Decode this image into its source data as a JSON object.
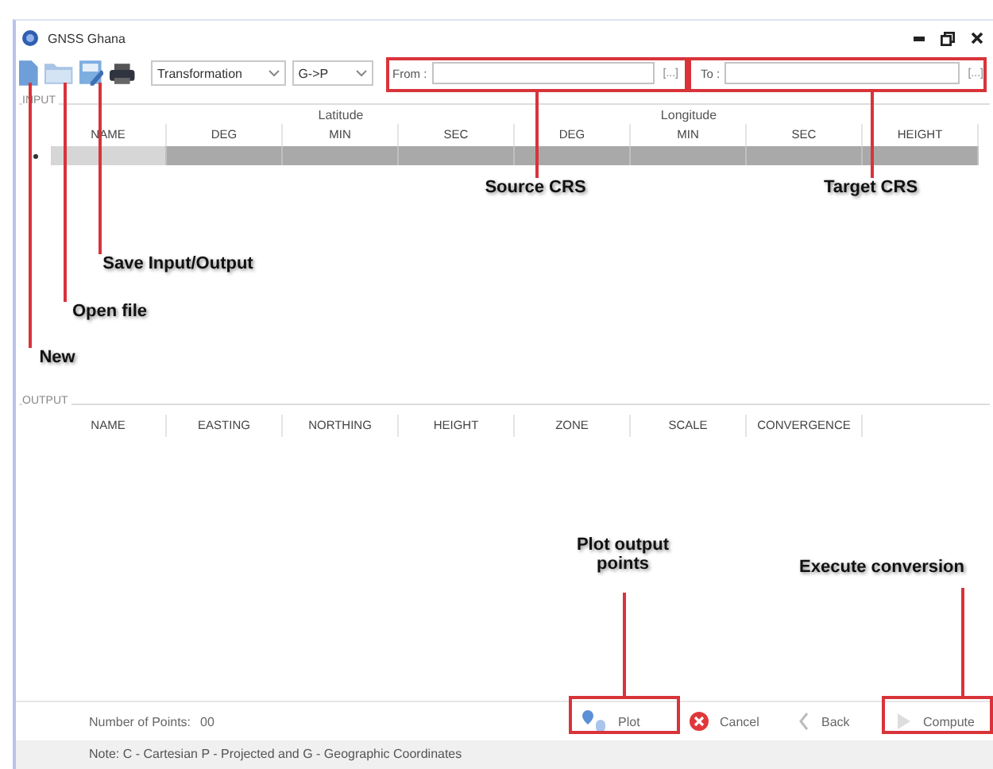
{
  "window": {
    "title": "GNSS Ghana"
  },
  "toolbar": {
    "dropdowns": [
      {
        "value": "Transformation"
      },
      {
        "value": "G->P"
      }
    ],
    "crs_fields": [
      {
        "label": "From :",
        "browse": "[...]"
      },
      {
        "label": "To :",
        "browse": "[...]"
      }
    ]
  },
  "input": {
    "legend": "INPUT",
    "column_groups": [
      {
        "columns": [
          "NAME"
        ]
      },
      {
        "label": "Latitude",
        "columns": [
          "DEG",
          "MIN",
          "SEC"
        ]
      },
      {
        "label": "Longitude",
        "columns": [
          "DEG",
          "MIN",
          "SEC"
        ]
      },
      {
        "columns": [
          "HEIGHT"
        ]
      }
    ],
    "rows": [
      {
        "selected": true
      }
    ]
  },
  "output": {
    "legend": "OUTPUT",
    "columns": [
      "NAME",
      "EASTING",
      "NORTHING",
      "HEIGHT",
      "ZONE",
      "SCALE",
      "CONVERGENCE"
    ]
  },
  "footer": {
    "points_label": "Number of Points:",
    "points": "00",
    "buttons": [
      {
        "kind": "plot",
        "label": "Plot"
      },
      {
        "kind": "cancel",
        "label": "Cancel"
      },
      {
        "kind": "back",
        "label": "Back"
      },
      {
        "kind": "compute",
        "label": "Compute"
      }
    ]
  },
  "note": "Note: C - Cartesian  P - Projected  and G - Geographic Coordinates",
  "annotations": [
    {
      "kind": "from",
      "text": "Source CRS"
    },
    {
      "kind": "to",
      "text": "Target CRS"
    },
    {
      "kind": "save",
      "text": "Save Input/Output"
    },
    {
      "kind": "open",
      "text": "Open file"
    },
    {
      "kind": "new",
      "text": "New"
    },
    {
      "kind": "plot",
      "text": "Plot output points"
    },
    {
      "kind": "compute",
      "text": "Execute conversion"
    }
  ]
}
